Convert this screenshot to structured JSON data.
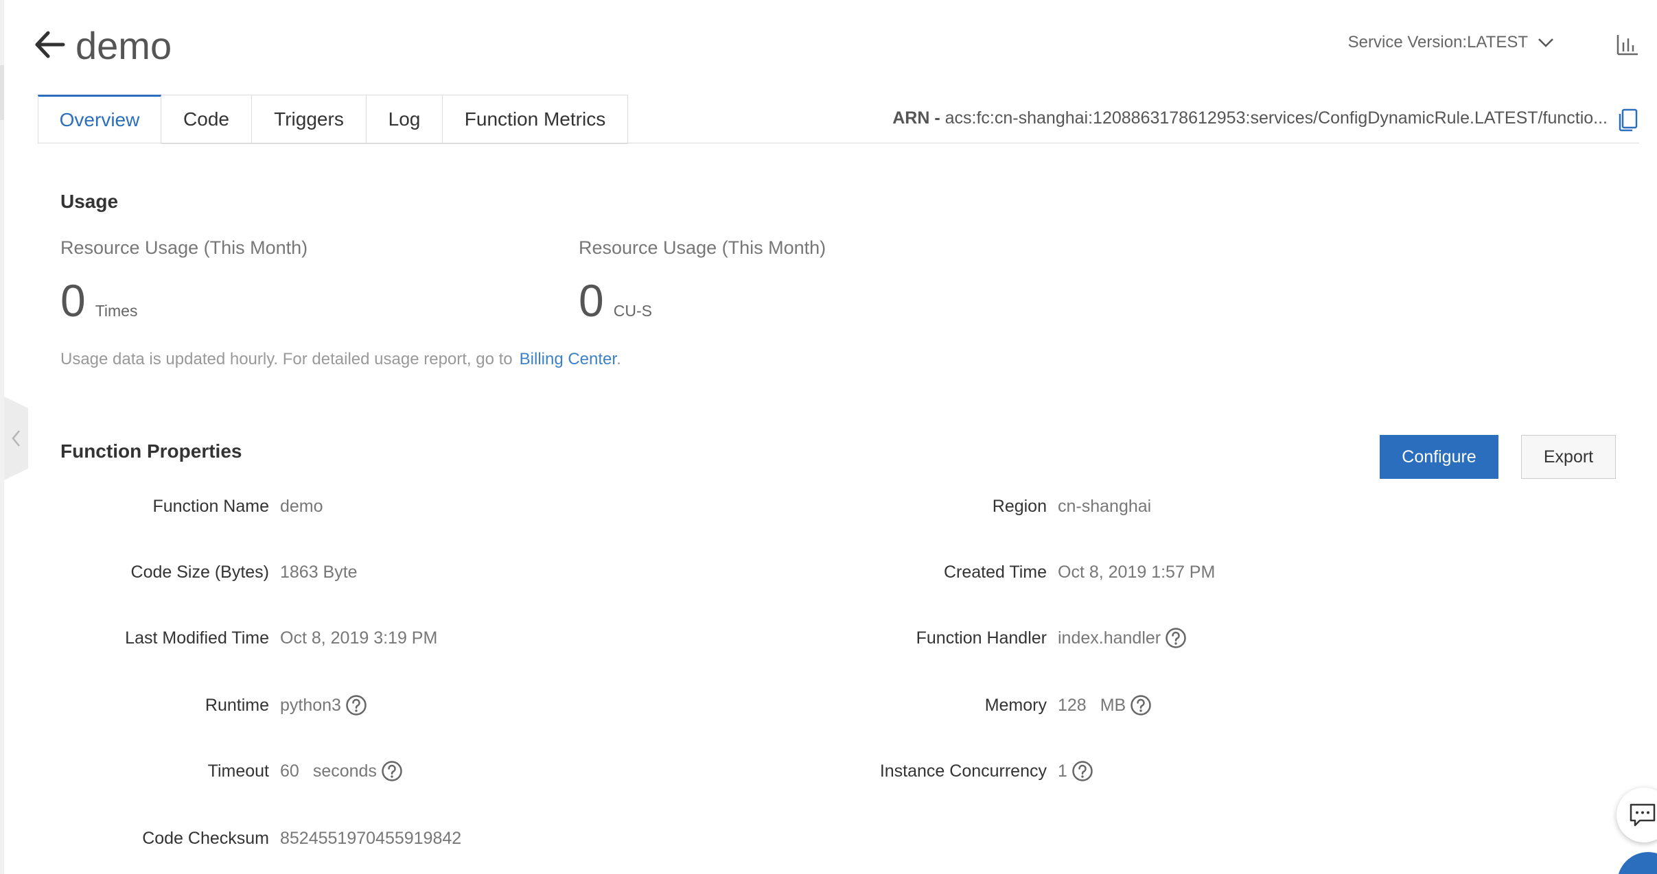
{
  "header": {
    "title": "demo",
    "service_version": "Service Version:LATEST"
  },
  "tabs": [
    {
      "label": "Overview",
      "active": true
    },
    {
      "label": "Code",
      "active": false
    },
    {
      "label": "Triggers",
      "active": false
    },
    {
      "label": "Log",
      "active": false
    },
    {
      "label": "Function Metrics",
      "active": false
    }
  ],
  "arn": {
    "prefix": "ARN -",
    "value": "acs:fc:cn-shanghai:1208863178612953:services/ConfigDynamicRule.LATEST/functio..."
  },
  "usage": {
    "title": "Usage",
    "items": [
      {
        "label": "Resource Usage (This Month)",
        "value": "0",
        "unit": "Times"
      },
      {
        "label": "Resource Usage (This Month)",
        "value": "0",
        "unit": "CU-S"
      }
    ],
    "note": "Usage data is updated hourly. For detailed usage report, go to",
    "link": "Billing Center",
    "note_end": "."
  },
  "properties": {
    "title": "Function Properties",
    "configure_label": "Configure",
    "export_label": "Export",
    "left": [
      {
        "label": "Function Name",
        "value": "demo",
        "unit": "",
        "help": false
      },
      {
        "label": "Code Size (Bytes)",
        "value": "1863 Byte",
        "unit": "",
        "help": false
      },
      {
        "label": "Last Modified Time",
        "value": "Oct 8, 2019 3:19 PM",
        "unit": "",
        "help": false
      },
      {
        "label": "Runtime",
        "value": "python3",
        "unit": "",
        "help": true
      },
      {
        "label": "Timeout",
        "value": "60",
        "unit": "seconds",
        "help": true
      },
      {
        "label": "Code Checksum",
        "value": "8524551970455919842",
        "unit": "",
        "help": false
      }
    ],
    "right": [
      {
        "label": "Region",
        "value": "cn-shanghai",
        "unit": "",
        "help": false
      },
      {
        "label": "Created Time",
        "value": "Oct 8, 2019 1:57 PM",
        "unit": "",
        "help": false
      },
      {
        "label": "Function Handler",
        "value": "index.handler",
        "unit": "",
        "help": true
      },
      {
        "label": "Memory",
        "value": "128",
        "unit": "MB",
        "help": true
      },
      {
        "label": "Instance Concurrency",
        "value": "1",
        "unit": "",
        "help": true
      }
    ]
  },
  "icons": {
    "back": "arrow-left-icon",
    "version_dropdown": "chevron-down-icon",
    "metrics": "bar-chart-icon",
    "copy": "copy-icon",
    "help": "question-circle-icon",
    "chat": "chat-icon",
    "collapse": "chevron-left-icon"
  },
  "colors": {
    "accent": "#2a6ebd",
    "link": "#3d82c7"
  }
}
